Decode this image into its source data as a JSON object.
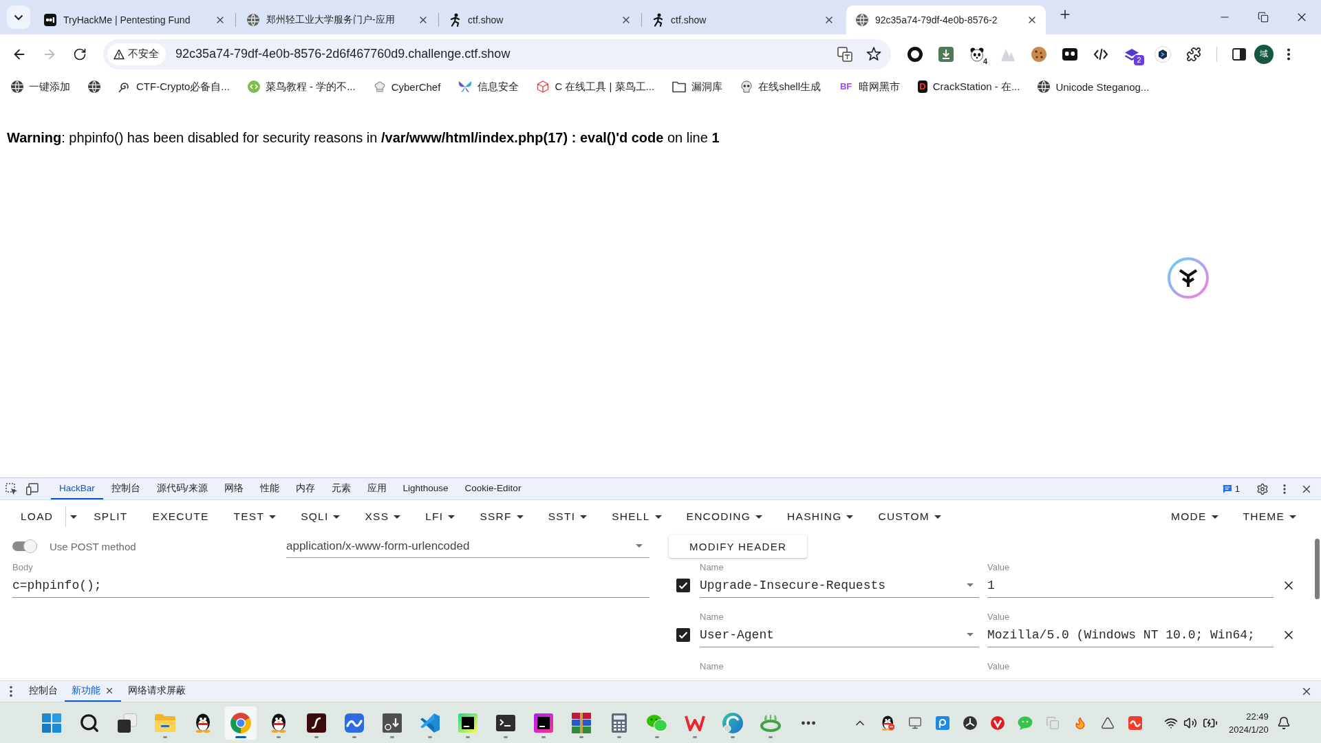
{
  "browser": {
    "tabs": [
      {
        "title": "TryHackMe | Pentesting Fund",
        "selected": false
      },
      {
        "title": "郑州轻工业大学服务门户-应用",
        "selected": false
      },
      {
        "title": "ctf.show",
        "selected": false
      },
      {
        "title": "ctf.show",
        "selected": false
      },
      {
        "title": "92c35a74-79df-4e0b-8576-2",
        "selected": true
      }
    ],
    "navigation": {
      "back_disabled": false,
      "forward_disabled": true
    },
    "address_bar": {
      "security_label": "不安全",
      "url": "92c35a74-79df-4e0b-8576-2d6f467760d9.challenge.ctf.show"
    },
    "extensions": [
      {
        "badge": "4"
      },
      {
        "badge": "2"
      }
    ],
    "profile": {
      "initial": "域"
    },
    "bookmarks": [
      {
        "kind": "link",
        "label": "一键添加"
      },
      {
        "kind": "icon"
      },
      {
        "kind": "link",
        "label": "CTF-Crypto必备自..."
      },
      {
        "kind": "link",
        "label": "菜鸟教程 - 学的不..."
      },
      {
        "kind": "link",
        "label": "CyberChef"
      },
      {
        "kind": "link",
        "label": "信息安全"
      },
      {
        "kind": "link",
        "label": "C 在线工具 | 菜鸟工..."
      },
      {
        "kind": "folder",
        "label": "漏洞库"
      },
      {
        "kind": "link",
        "label": "在线shell生成"
      },
      {
        "kind": "link",
        "label": "暗网黑市",
        "icon_text": "BF"
      },
      {
        "kind": "link",
        "label": "CrackStation - 在...",
        "icon_text": "D"
      },
      {
        "kind": "link",
        "label": "Unicode Steganog..."
      }
    ]
  },
  "page": {
    "warning": "**Warning**: phpinfo() has been disabled for security reasons in **/var/www/html/index.php(17) : eval()'d code** on line **1**"
  },
  "devtools": {
    "tool_tabs": [
      {
        "label": "HackBar",
        "selected": true
      },
      {
        "label": "控制台",
        "selected": false
      },
      {
        "label": "源代码/来源",
        "selected": false
      },
      {
        "label": "网络",
        "selected": false
      },
      {
        "label": "性能",
        "selected": false
      },
      {
        "label": "内存",
        "selected": false
      },
      {
        "label": "元素",
        "selected": false
      },
      {
        "label": "应用",
        "selected": false
      },
      {
        "label": "Lighthouse",
        "selected": false
      },
      {
        "label": "Cookie-Editor",
        "selected": false
      }
    ],
    "issues_count": "1",
    "hackbar": {
      "actions": [
        {
          "label": "LOAD",
          "kind": "split"
        },
        {
          "label": "SPLIT",
          "kind": "button"
        },
        {
          "label": "EXECUTE",
          "kind": "button"
        },
        {
          "label": "TEST",
          "kind": "menu"
        },
        {
          "label": "SQLI",
          "kind": "menu"
        },
        {
          "label": "XSS",
          "kind": "menu"
        },
        {
          "label": "LFI",
          "kind": "menu"
        },
        {
          "label": "SSRF",
          "kind": "menu"
        },
        {
          "label": "SSTI",
          "kind": "menu"
        },
        {
          "label": "SHELL",
          "kind": "menu"
        },
        {
          "label": "ENCODING",
          "kind": "menu"
        },
        {
          "label": "HASHING",
          "kind": "menu"
        },
        {
          "label": "CUSTOM",
          "kind": "menu"
        }
      ],
      "settings_menus": [
        {
          "label": "MODE"
        },
        {
          "label": "THEME"
        }
      ],
      "post_method": {
        "label": "Use POST method",
        "on": true
      },
      "content_type": "application/x-www-form-urlencoded",
      "modify_header": "MODIFY HEADER",
      "body": {
        "label": "Body",
        "value": "c=phpinfo();"
      },
      "headers": [
        {
          "name_label": "Name",
          "value_label": "Value",
          "checked": true,
          "name": "Upgrade-Insecure-Requests",
          "value": "1"
        },
        {
          "name_label": "Name",
          "value_label": "Value",
          "checked": true,
          "name": "User-Agent",
          "value": "Mozilla/5.0 (Windows NT 10.0; Win64;"
        },
        {
          "name_label": "Name",
          "value_label": "Value"
        }
      ]
    },
    "drawer_tabs": [
      {
        "label": "控制台",
        "selected": false,
        "closable": false
      },
      {
        "label": "新功能",
        "selected": true,
        "closable": true
      },
      {
        "label": "网络请求屏蔽",
        "selected": false,
        "closable": false
      }
    ]
  },
  "taskbar": {
    "apps": [
      {
        "running": false,
        "selected": false
      },
      {
        "running": false,
        "selected": false
      },
      {
        "running": false,
        "selected": false
      },
      {
        "running": true,
        "selected": false
      },
      {
        "running": false,
        "selected": false
      },
      {
        "running": true,
        "selected": true
      },
      {
        "running": true,
        "selected": false
      },
      {
        "running": true,
        "selected": false
      },
      {
        "running": true,
        "selected": false
      },
      {
        "running": true,
        "selected": false
      },
      {
        "running": true,
        "selected": false
      },
      {
        "running": true,
        "selected": false
      },
      {
        "running": true,
        "selected": false
      },
      {
        "running": true,
        "selected": false
      },
      {
        "running": true,
        "selected": false
      },
      {
        "running": true,
        "selected": false
      },
      {
        "running": true,
        "selected": false
      },
      {
        "running": true,
        "selected": false
      },
      {
        "running": true,
        "selected": false
      },
      {
        "running": true,
        "selected": false
      },
      {
        "running": false,
        "selected": false
      }
    ],
    "clock": {
      "time": "22:49",
      "date": "2024/1/20"
    }
  }
}
